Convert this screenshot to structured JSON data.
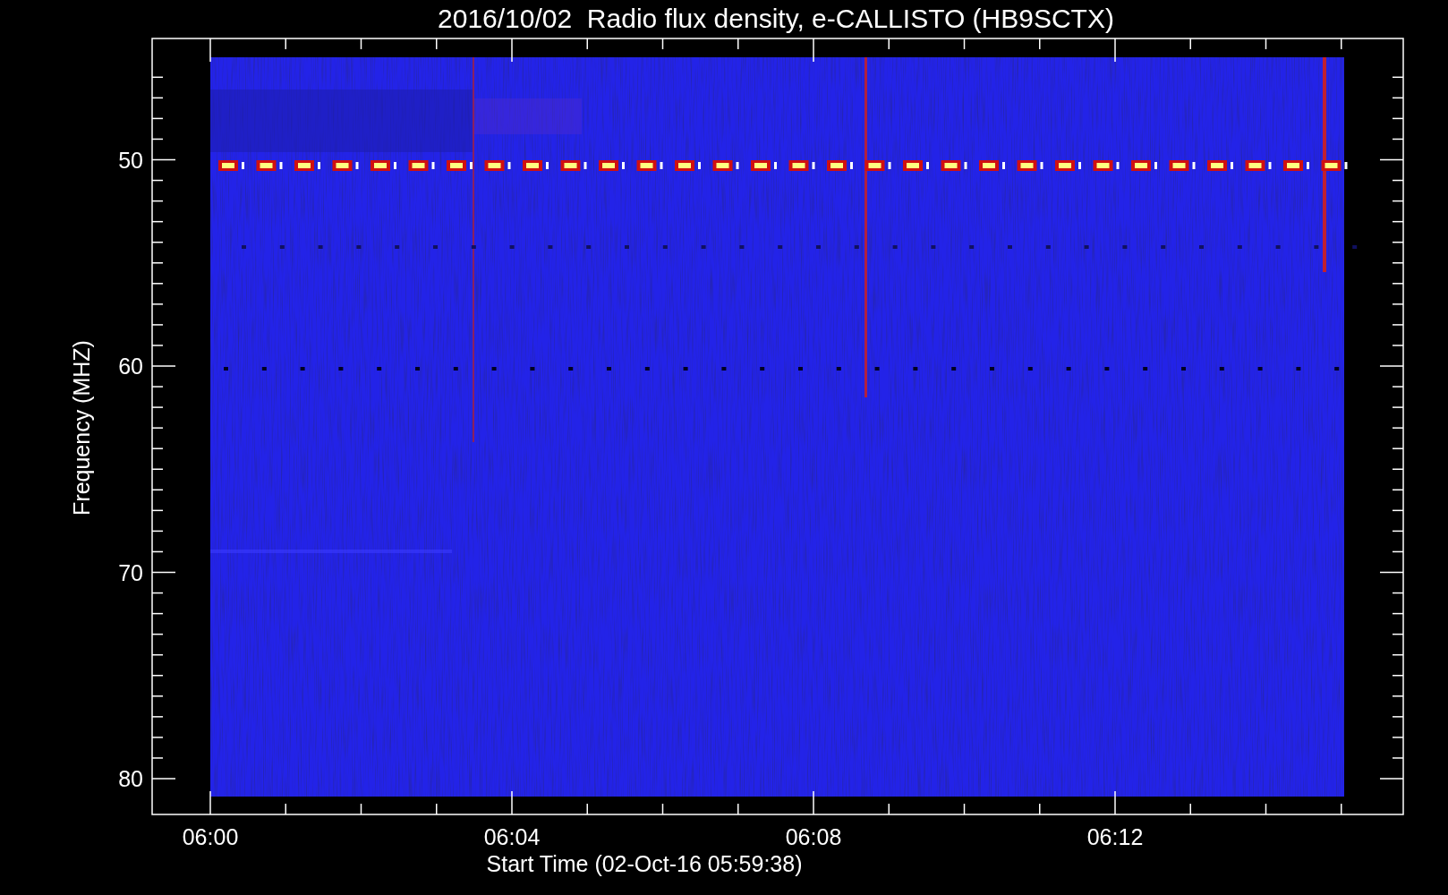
{
  "title": "2016/10/02  Radio flux density, e-CALLISTO (HB9SCTX)",
  "xlabel": "Start Time (02-Oct-16 05:59:38)",
  "ylabel": "Frequency (MHZ)",
  "yticks": [
    "50",
    "60",
    "70",
    "80"
  ],
  "xticks": [
    "06:00",
    "06:04",
    "06:08",
    "06:12"
  ]
}
